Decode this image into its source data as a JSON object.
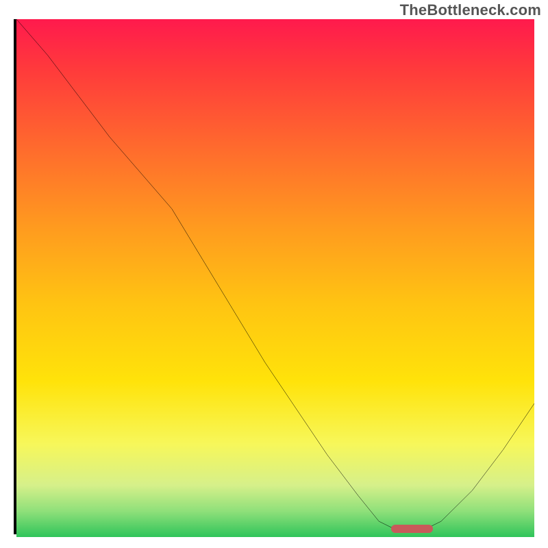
{
  "watermark": "TheBottleneck.com",
  "chart_data": {
    "type": "line",
    "title": "",
    "xlabel": "",
    "ylabel": "",
    "xlim": [
      0,
      100
    ],
    "ylim": [
      0,
      100
    ],
    "x": [
      0,
      6,
      12,
      18,
      24,
      30,
      36,
      42,
      48,
      54,
      60,
      66,
      70,
      74,
      78,
      82,
      88,
      94,
      100
    ],
    "values": [
      100,
      93,
      85,
      77,
      70,
      63,
      53,
      43,
      33,
      24,
      15,
      7,
      2,
      0,
      0,
      2,
      8,
      16,
      25
    ],
    "marker": {
      "x_start": 72,
      "x_end": 80,
      "y": 0
    },
    "gradient_stops": [
      {
        "pos": 0.0,
        "color": "#ff1a4d"
      },
      {
        "pos": 0.1,
        "color": "#ff3b3b"
      },
      {
        "pos": 0.25,
        "color": "#ff6b2d"
      },
      {
        "pos": 0.4,
        "color": "#ff9a1f"
      },
      {
        "pos": 0.55,
        "color": "#ffc412"
      },
      {
        "pos": 0.7,
        "color": "#ffe30a"
      },
      {
        "pos": 0.82,
        "color": "#f7f75a"
      },
      {
        "pos": 0.9,
        "color": "#d6f08a"
      },
      {
        "pos": 0.95,
        "color": "#8fe07a"
      },
      {
        "pos": 1.0,
        "color": "#2fc45a"
      }
    ]
  }
}
